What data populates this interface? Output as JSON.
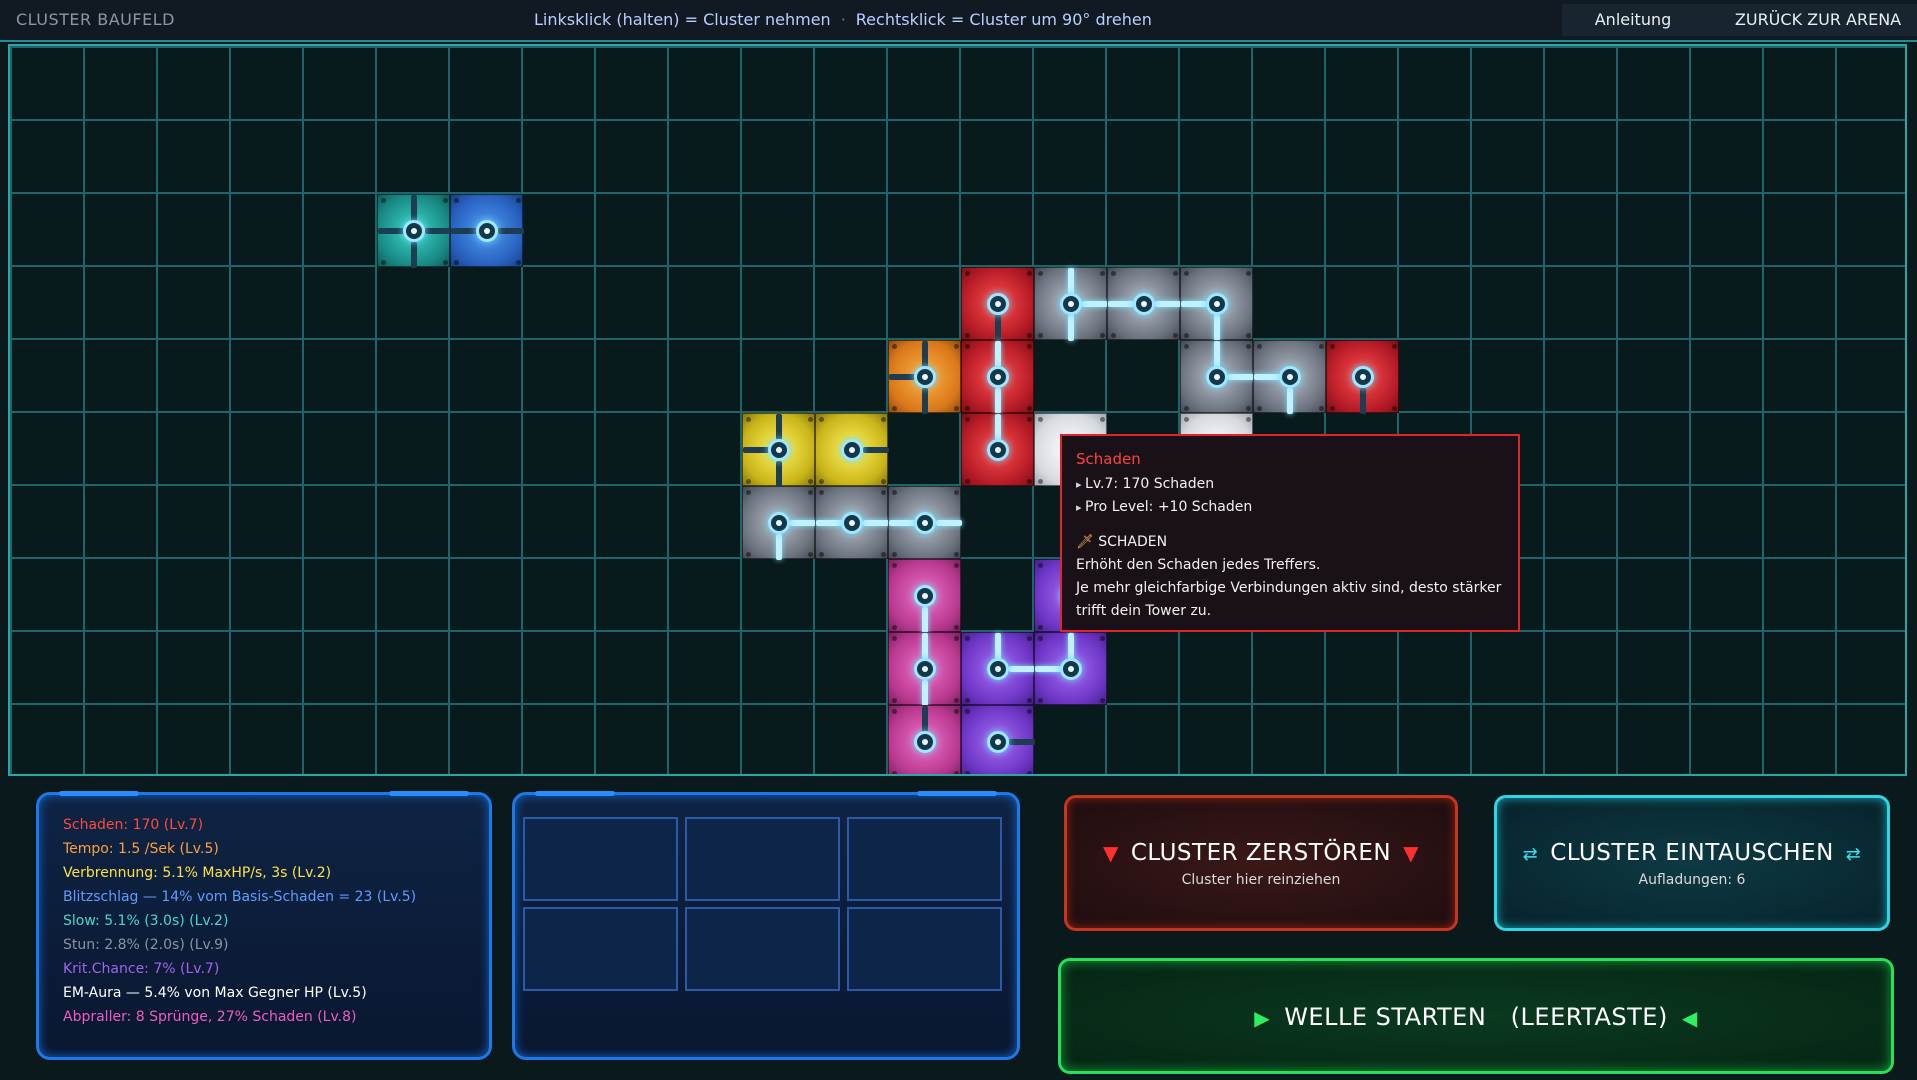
{
  "topbar": {
    "title": "CLUSTER BAUFELD",
    "hint_left": "Linksklick (halten) = Cluster nehmen",
    "hint_sep": "·",
    "hint_right": "Rechtsklick = Cluster um 90° drehen",
    "guide_label": "Anleitung",
    "back_label": "ZURÜCK ZUR ARENA"
  },
  "colors": {
    "grid_line": "#1f6468",
    "grid_border": "#2aa6a6",
    "panel_border": "#1e78e8",
    "destroy_border": "#c8351e",
    "swap_border": "#2fd6e6",
    "start_border": "#26e05a",
    "tooltip_border": "#e0242c"
  },
  "tooltip": {
    "title": "Schaden",
    "line1": "Lv.7: 170 Schaden",
    "line2": "Pro Level: +10 Schaden",
    "section_icon": "sword-icon",
    "section_title": "SCHADEN",
    "desc1": "Erhöht den Schaden jedes Treffers.",
    "desc2": "Je mehr gleichfarbige Verbindungen aktiv sind, desto stärker trifft dein Tower zu."
  },
  "stats": [
    {
      "text": "Schaden: 170 (Lv.7)",
      "color": "#ff4a3d"
    },
    {
      "text": "Tempo: 1.5 /Sek (Lv.5)",
      "color": "#ffa03a"
    },
    {
      "text": "Verbrennung: 5.1% MaxHP/s, 3s (Lv.2)",
      "color": "#ffe04a"
    },
    {
      "text": "Blitzschlag — 14% vom Basis-Schaden = 23 (Lv.5)",
      "color": "#5f9cff"
    },
    {
      "text": "Slow: 5.1% (3.0s) (Lv.2)",
      "color": "#49d8d0"
    },
    {
      "text": "Stun: 2.8% (2.0s) (Lv.9)",
      "color": "#8b939e"
    },
    {
      "text": "Krit.Chance: 7% (Lv.7)",
      "color": "#a062f0"
    },
    {
      "text": "EM-Aura — 5.4% von Max Gegner HP (Lv.5)",
      "color": "#ffffff"
    },
    {
      "text": "Abpraller: 8 Sprünge, 27% Schaden (Lv.8)",
      "color": "#ef5cc0"
    }
  ],
  "actions": {
    "destroy_label": "CLUSTER ZERSTÖREN",
    "destroy_sub": "Cluster hier reinziehen",
    "swap_label": "CLUSTER EINTAUSCHEN",
    "swap_sub": "Aufladungen: 6",
    "start_label": "WELLE STARTEN",
    "start_key": "(LEERTASTE)"
  }
}
